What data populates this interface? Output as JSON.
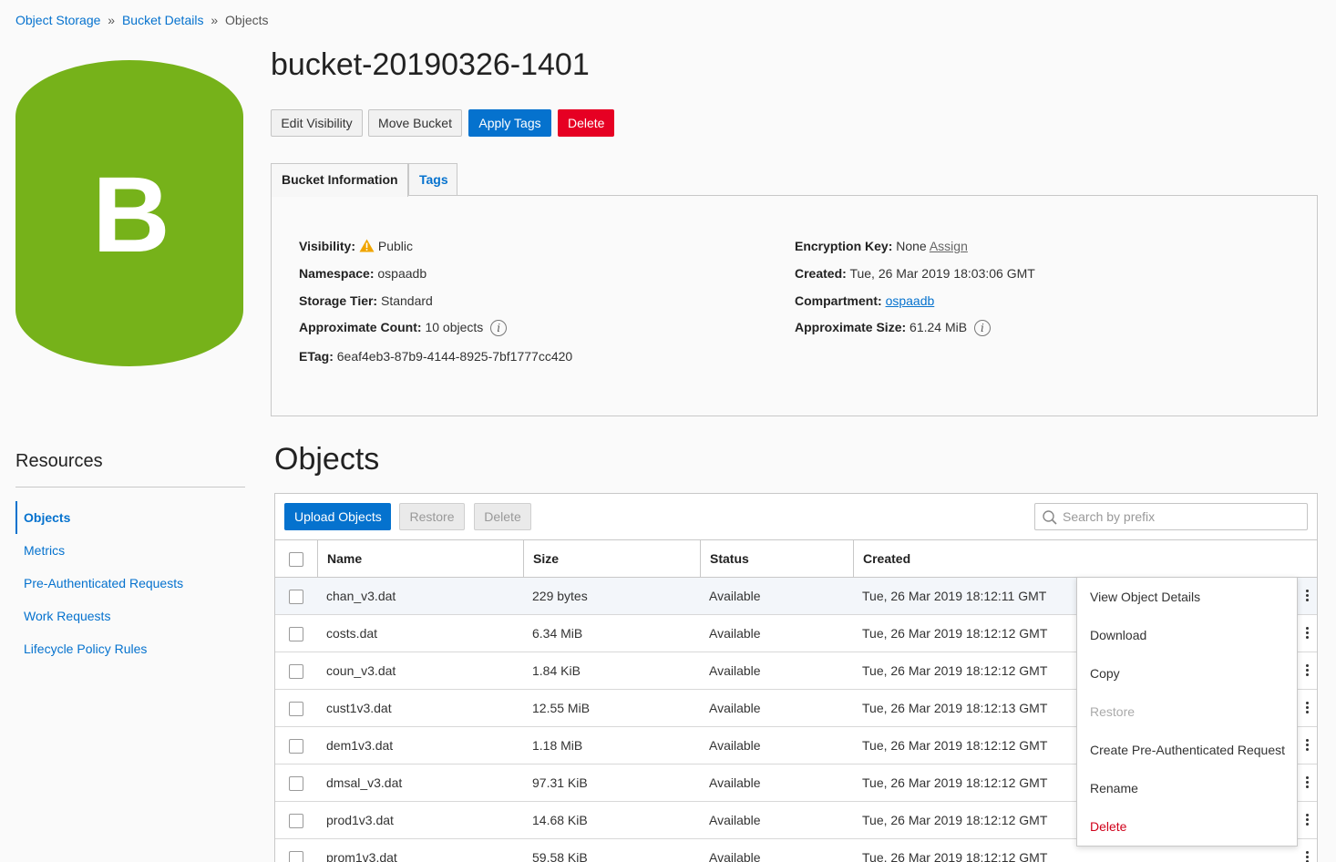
{
  "breadcrumb": {
    "items": [
      "Object Storage",
      "Bucket Details",
      "Objects"
    ],
    "separator": "»"
  },
  "bucket_icon": {
    "letter": "B",
    "color": "#76b21a"
  },
  "page_title": "bucket-20190326-1401",
  "actions": {
    "edit_visibility": "Edit Visibility",
    "move_bucket": "Move Bucket",
    "apply_tags": "Apply Tags",
    "delete": "Delete"
  },
  "tabs": {
    "bucket_info": "Bucket Information",
    "tags": "Tags"
  },
  "info": {
    "visibility_k": "Visibility:",
    "visibility_v": "Public",
    "namespace_k": "Namespace:",
    "namespace_v": "ospaadb",
    "storage_tier_k": "Storage Tier:",
    "storage_tier_v": "Standard",
    "approx_count_k": "Approximate Count:",
    "approx_count_v": "10 objects",
    "etag_k": "ETag:",
    "etag_v": "6eaf4eb3-87b9-4144-8925-7bf1777cc420",
    "enc_key_k": "Encryption Key:",
    "enc_key_v": "None",
    "enc_key_link": "Assign",
    "created_k": "Created:",
    "created_v": "Tue, 26 Mar 2019 18:03:06 GMT",
    "compartment_k": "Compartment:",
    "compartment_v": "ospaadb",
    "approx_size_k": "Approximate Size:",
    "approx_size_v": "61.24 MiB",
    "info_glyph": "i"
  },
  "resources": {
    "title": "Resources",
    "items": [
      "Objects",
      "Metrics",
      "Pre-Authenticated Requests",
      "Work Requests",
      "Lifecycle Policy Rules"
    ]
  },
  "objects": {
    "title": "Objects",
    "upload": "Upload Objects",
    "restore": "Restore",
    "delete": "Delete",
    "search_placeholder": "Search by prefix",
    "columns": [
      "Name",
      "Size",
      "Status",
      "Created"
    ],
    "rows": [
      {
        "name": "chan_v3.dat",
        "size": "229 bytes",
        "status": "Available",
        "created": "Tue, 26 Mar 2019 18:12:11 GMT"
      },
      {
        "name": "costs.dat",
        "size": "6.34 MiB",
        "status": "Available",
        "created": "Tue, 26 Mar 2019 18:12:12 GMT"
      },
      {
        "name": "coun_v3.dat",
        "size": "1.84 KiB",
        "status": "Available",
        "created": "Tue, 26 Mar 2019 18:12:12 GMT"
      },
      {
        "name": "cust1v3.dat",
        "size": "12.55 MiB",
        "status": "Available",
        "created": "Tue, 26 Mar 2019 18:12:13 GMT"
      },
      {
        "name": "dem1v3.dat",
        "size": "1.18 MiB",
        "status": "Available",
        "created": "Tue, 26 Mar 2019 18:12:12 GMT"
      },
      {
        "name": "dmsal_v3.dat",
        "size": "97.31 KiB",
        "status": "Available",
        "created": "Tue, 26 Mar 2019 18:12:12 GMT"
      },
      {
        "name": "prod1v3.dat",
        "size": "14.68 KiB",
        "status": "Available",
        "created": "Tue, 26 Mar 2019 18:12:12 GMT"
      },
      {
        "name": "prom1v3.dat",
        "size": "59.58 KiB",
        "status": "Available",
        "created": "Tue, 26 Mar 2019 18:12:12 GMT"
      }
    ]
  },
  "context_menu": {
    "items": [
      "View Object Details",
      "Download",
      "Copy",
      "Restore",
      "Create Pre-Authenticated Request",
      "Rename",
      "Delete"
    ]
  }
}
